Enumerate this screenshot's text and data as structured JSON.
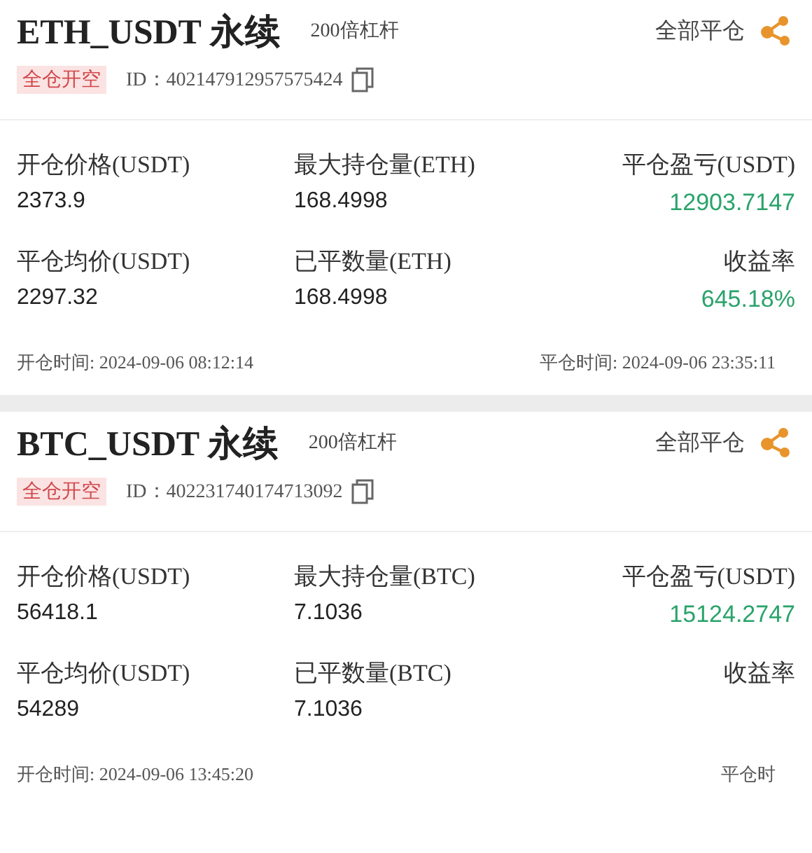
{
  "positions": [
    {
      "title": "ETH_USDT 永续",
      "leverage": "200倍杠杆",
      "close_all": "全部平仓",
      "tag": "全仓开空",
      "id": "ID：402147912957575424",
      "stats": [
        {
          "label": "开仓价格(USDT)",
          "value": "2373.9"
        },
        {
          "label": "最大持仓量(ETH)",
          "value": "168.4998"
        },
        {
          "label": "平仓盈亏(USDT)",
          "value": "12903.7147",
          "color": "#2aa36b"
        },
        {
          "label": "平仓均价(USDT)",
          "value": "2297.32"
        },
        {
          "label": "已平数量(ETH)",
          "value": "168.4998"
        },
        {
          "label": "收益率",
          "value": "645.18%",
          "color": "#2aa36b"
        }
      ],
      "open_time": "开仓时间: 2024-09-06 08:12:14",
      "close_time": "平仓时间: 2024-09-06 23:35:11"
    },
    {
      "title": "BTC_USDT 永续",
      "leverage": "200倍杠杆",
      "close_all": "全部平仓",
      "tag": "全仓开空",
      "id": "ID：402231740174713092",
      "stats": [
        {
          "label": "开仓价格(USDT)",
          "value": "56418.1"
        },
        {
          "label": "最大持仓量(BTC)",
          "value": "7.1036"
        },
        {
          "label": "平仓盈亏(USDT)",
          "value": "15124.2747",
          "color": "#2aa36b"
        },
        {
          "label": "平仓均价(USDT)",
          "value": "54289"
        },
        {
          "label": "已平数量(BTC)",
          "value": "7.1036"
        },
        {
          "label": "收益率"
        }
      ],
      "open_time": "开仓时间: 2024-09-06 13:45:20",
      "close_time": "平仓时"
    }
  ]
}
